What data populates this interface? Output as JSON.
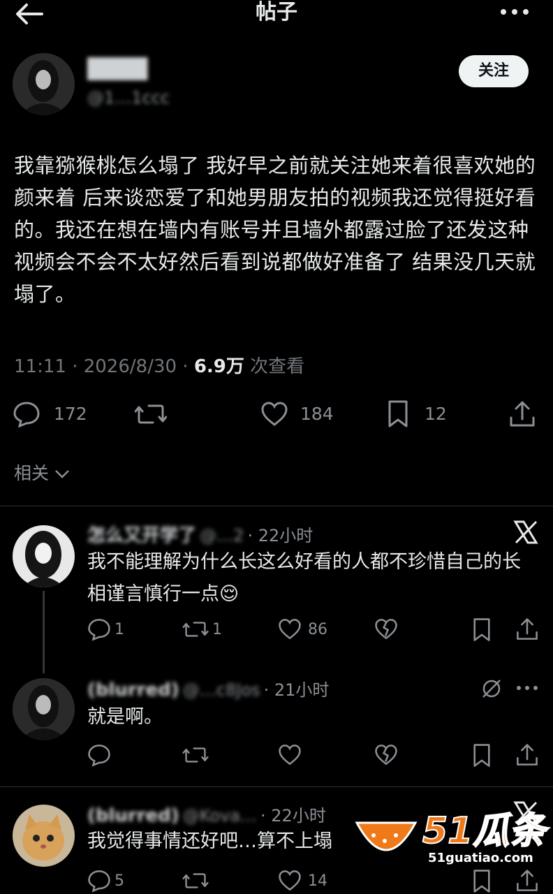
{
  "header": {
    "title": "帖子"
  },
  "author": {
    "name": "(blurred)",
    "handle": "@1…1ccc",
    "follow_label": "关注"
  },
  "post": {
    "text": "我靠猕猴桃怎么塌了 我好早之前就关注她来着很喜欢她的颜来着 后来谈恋爱了和她男朋友拍的视频我还觉得挺好看的。我还在想在墙内有账号并且墙外都露过脸了还发这种视频会不会不太好然后看到说都做好准备了 结果没几天就塌了。",
    "time": "11:11 · 2026/8/30 · ",
    "views": "6.9万",
    "views_label": " 次查看",
    "actions": {
      "replies": "172",
      "likes": "184",
      "bookmarks": "12"
    }
  },
  "related_label": "相关",
  "comments": [
    {
      "name": "怎么又开学了",
      "handle": "@…2",
      "time": "· 22小时",
      "text": "我不能理解为什么长这么好看的人都不珍惜自己的长相谨言慎行一点😌",
      "replies": "1",
      "retweets": "1",
      "likes": "86"
    },
    {
      "name": "(blurred)",
      "handle": "@…c8Jos",
      "time": "· 21小时",
      "text": "就是啊。"
    },
    {
      "name": "(blurred)",
      "handle": "@Kova…",
      "time": "· 22小时",
      "text": "我觉得事情还好吧…算不上塌",
      "replies": "5",
      "likes": "14"
    }
  ],
  "watermark": {
    "brand": "51瓜条",
    "url": "51guatiao.com"
  },
  "colors": {
    "bg": "#000000",
    "text": "#e7e9ea",
    "muted": "#71767b",
    "accent": "#f07a1a"
  }
}
